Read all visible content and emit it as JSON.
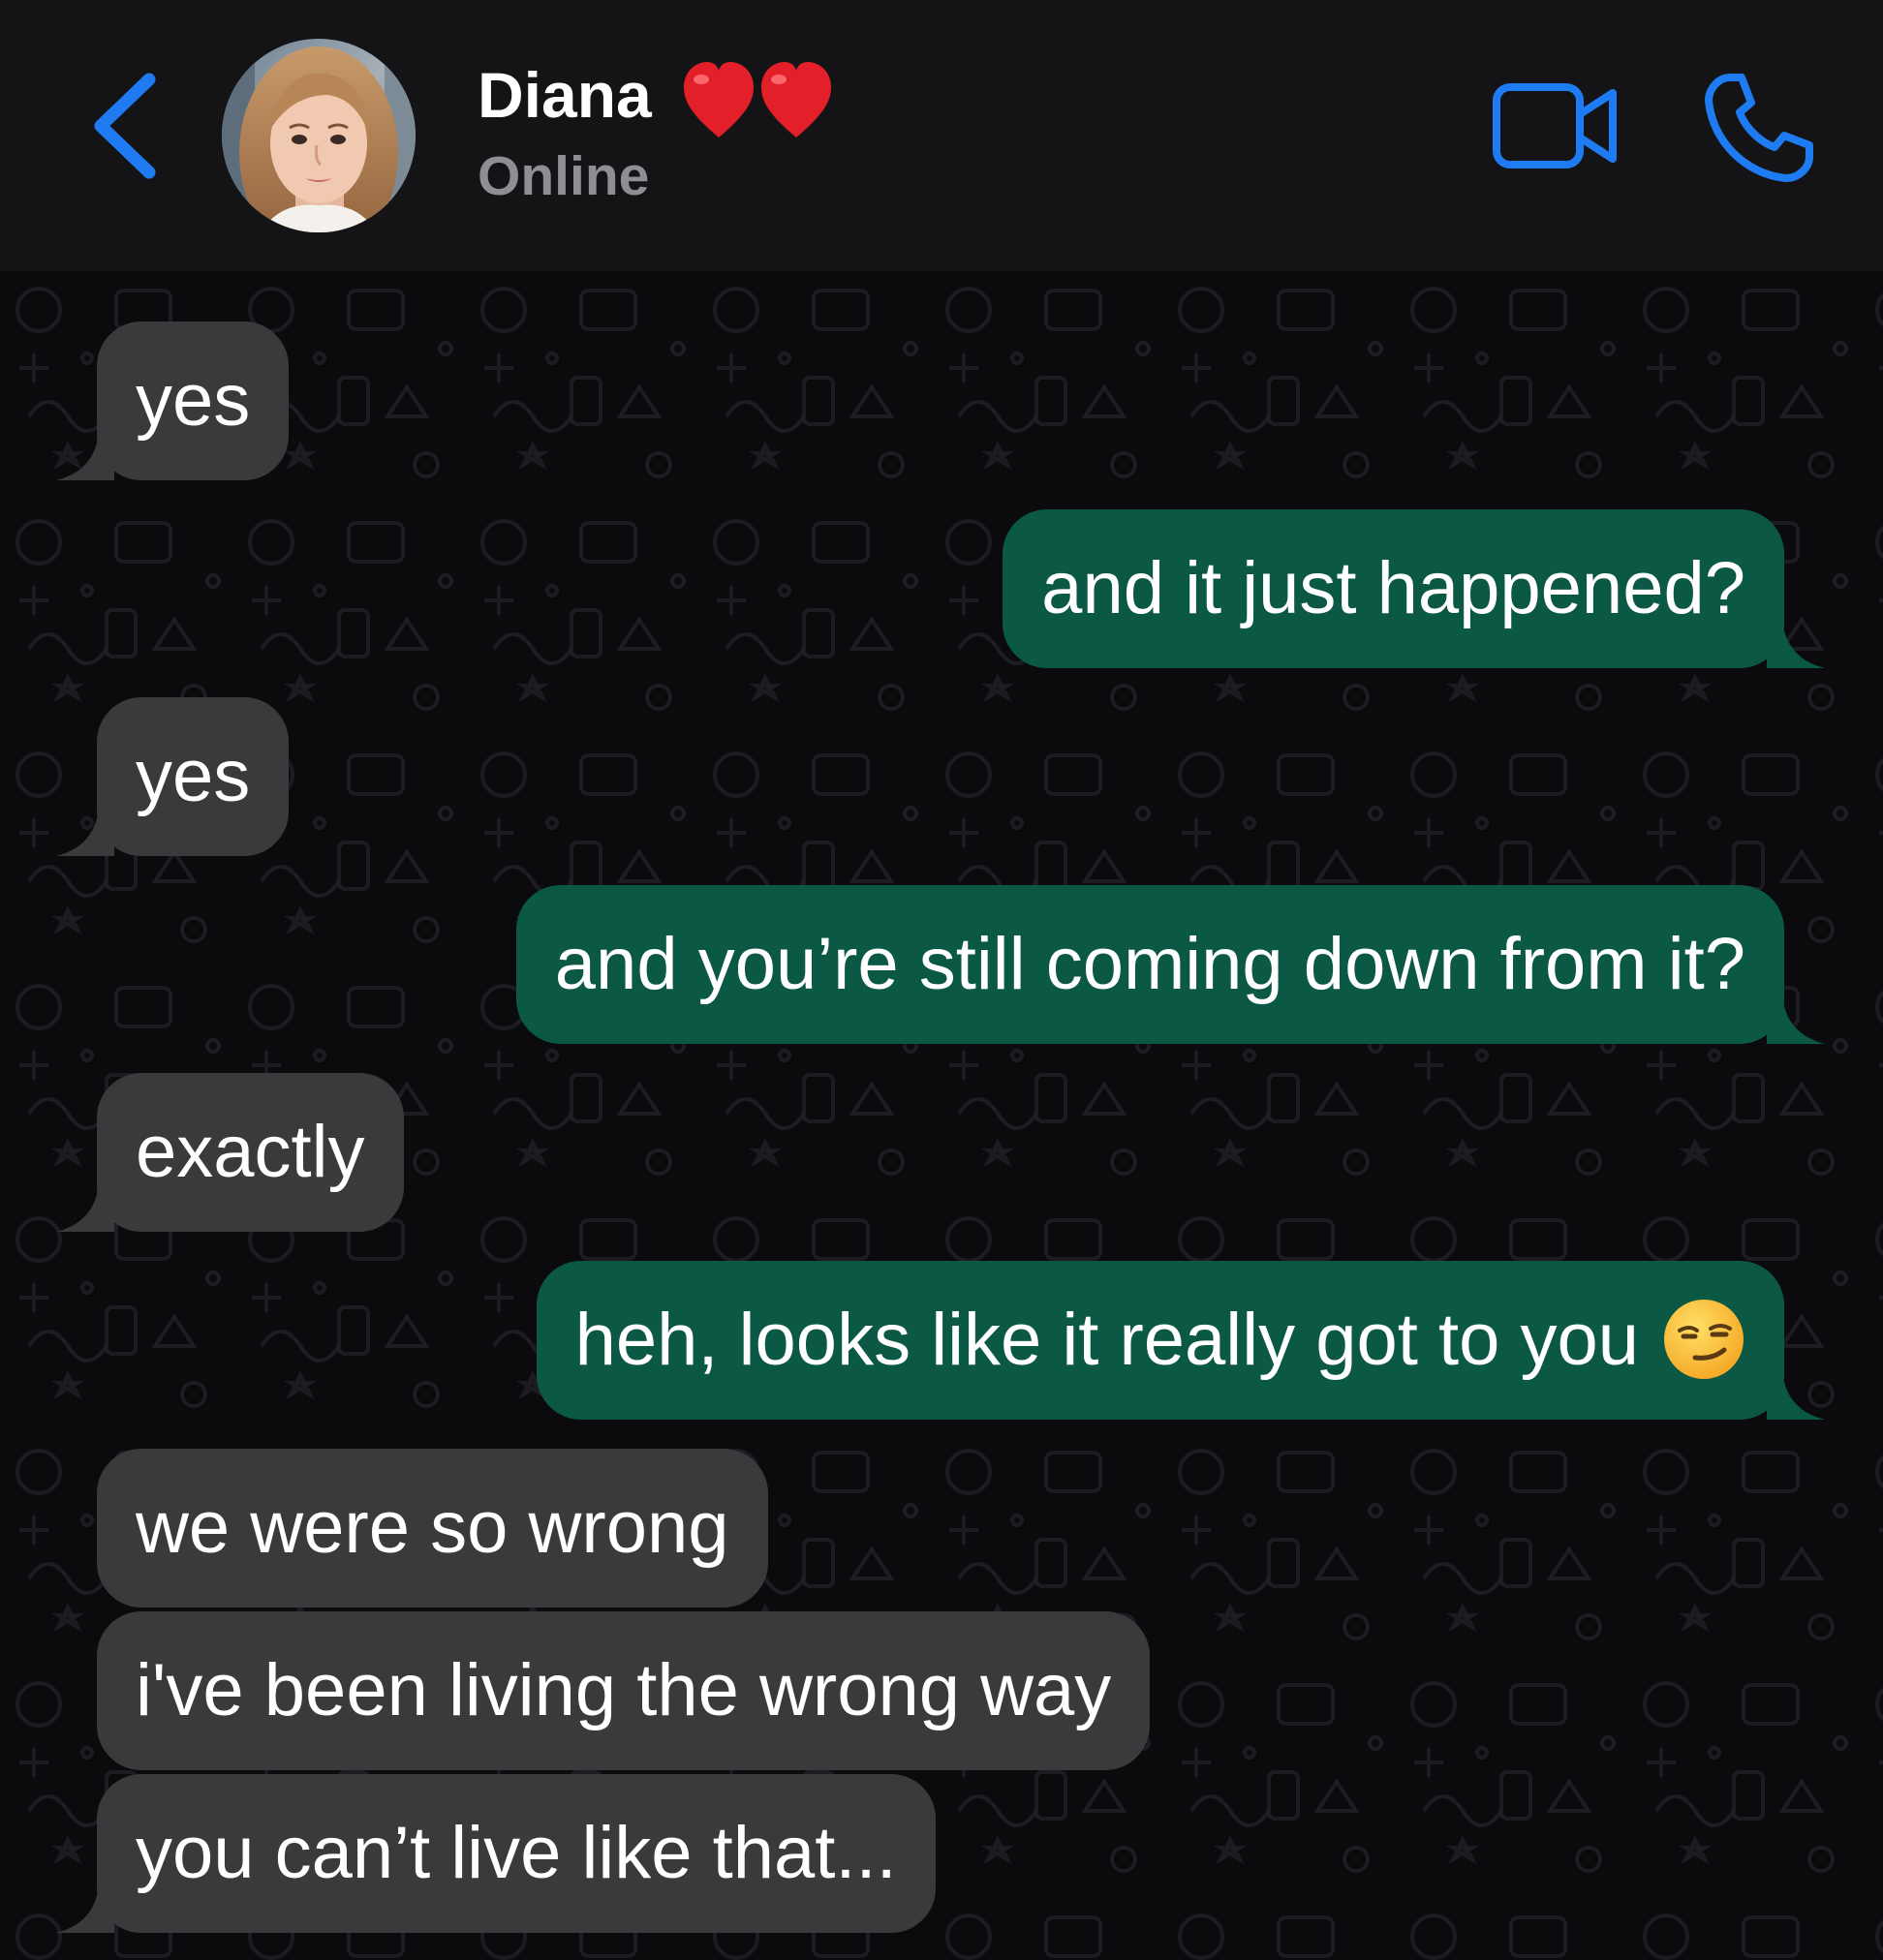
{
  "header": {
    "contact_name": "Diana",
    "name_emoji": "❤️❤️",
    "status": "Online",
    "back_icon": "chevron-left-icon",
    "video_icon": "video-camera-icon",
    "call_icon": "phone-icon",
    "accent_color": "#1e7bf2"
  },
  "messages": [
    {
      "direction": "in",
      "text": "yes"
    },
    {
      "direction": "out",
      "text": "and it just happened?"
    },
    {
      "direction": "in",
      "text": "yes"
    },
    {
      "direction": "out",
      "text": "and you’re still coming down from it?"
    },
    {
      "direction": "in",
      "text": "exactly"
    },
    {
      "direction": "out",
      "text": "heh, looks like it really got to you",
      "emoji": "😏"
    },
    {
      "direction": "in",
      "text": "we were so wrong"
    },
    {
      "direction": "in",
      "text": "i've been living the wrong way"
    },
    {
      "direction": "in",
      "text": "you can’t live like that..."
    }
  ],
  "colors": {
    "incoming_bubble": "#3a3a3c",
    "outgoing_bubble": "#0b5945",
    "header_bg": "#141416",
    "chat_bg": "#0b0b0e"
  }
}
